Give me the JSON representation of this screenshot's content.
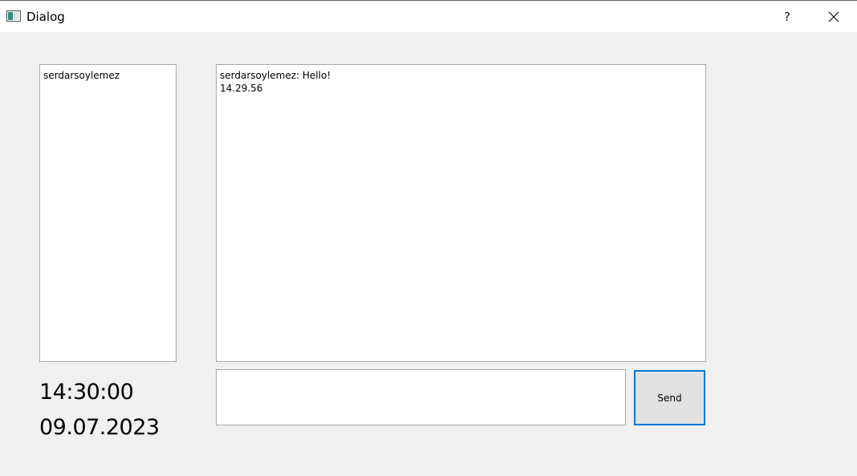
{
  "window": {
    "title": "Dialog",
    "help_label": "?"
  },
  "users": [
    "serdarsoylemez"
  ],
  "chat": {
    "lines": [
      "serdarsoylemez: Hello!",
      "14.29.56"
    ]
  },
  "clock": {
    "time": "14:30:00",
    "date": "09.07.2023"
  },
  "input": {
    "value": ""
  },
  "send_label": "Send",
  "colors": {
    "window_bg": "#f0f0f0",
    "titlebar_bg": "#ffffff",
    "focus_border": "#0078d7",
    "button_bg": "#e1e1e1"
  }
}
